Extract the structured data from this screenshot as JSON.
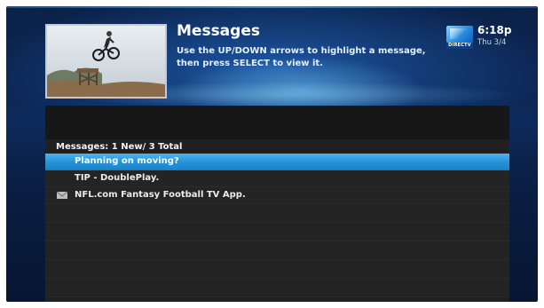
{
  "header": {
    "title": "Messages",
    "instructions": "Use the UP/DOWN arrows to highlight a message, then press SELECT to view it.",
    "logo_text": "DIRECTV",
    "time": "6:18p",
    "date": "Thu 3/4"
  },
  "thumbnail": {
    "icon": "bmx-rider-image"
  },
  "messages": {
    "summary": "Messages: 1 New/ 3 Total",
    "items": [
      {
        "label": "Planning on moving?",
        "unread": false,
        "selected": true
      },
      {
        "label": "TIP - DoublePlay.",
        "unread": false,
        "selected": false
      },
      {
        "label": "NFL.com Fantasy Football TV App.",
        "unread": true,
        "icon": "envelope-icon",
        "selected": false
      }
    ]
  },
  "colors": {
    "highlight": "#2592d8",
    "background": "#0c2a5a",
    "panel": "#202020"
  }
}
